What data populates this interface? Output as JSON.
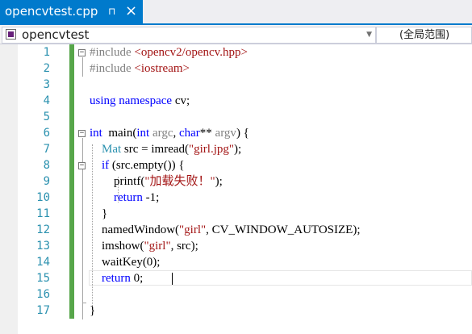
{
  "tab": {
    "title": "opencvtest.cpp",
    "pin_icon": "⊓",
    "close_icon": "×"
  },
  "navbar": {
    "scope": "opencvtest",
    "member": "(全局范围)",
    "dropdown_arrow": "▼"
  },
  "editor": {
    "fold_minus": "−",
    "lines": [
      {
        "num": "1",
        "code": "#include <opencv2/opencv.hpp>"
      },
      {
        "num": "2",
        "code": "#include <iostream>"
      },
      {
        "num": "3",
        "code": ""
      },
      {
        "num": "4",
        "code": "using namespace cv;"
      },
      {
        "num": "5",
        "code": ""
      },
      {
        "num": "6",
        "code": "int  main(int argc, char** argv) {"
      },
      {
        "num": "7",
        "code": "    Mat src = imread(\"girl.jpg\");"
      },
      {
        "num": "8",
        "code": "    if (src.empty()) {"
      },
      {
        "num": "9",
        "code": "        printf(\"加载失败！\");"
      },
      {
        "num": "10",
        "code": "        return -1;"
      },
      {
        "num": "11",
        "code": "    }"
      },
      {
        "num": "12",
        "code": "    namedWindow(\"girl\", CV_WINDOW_AUTOSIZE);"
      },
      {
        "num": "13",
        "code": "    imshow(\"girl\", src);"
      },
      {
        "num": "14",
        "code": "    waitKey(0);"
      },
      {
        "num": "15",
        "code": "    return 0;"
      },
      {
        "num": "16",
        "code": ""
      },
      {
        "num": "17",
        "code": "}"
      }
    ]
  },
  "colors": {
    "accent": "#007acc",
    "keyword": "#0000ff",
    "string": "#a31515",
    "preprocessor": "#808080",
    "type": "#2b91af",
    "parameter": "#808080",
    "line_number": "#2b91af",
    "changebar": "#57a64a"
  }
}
